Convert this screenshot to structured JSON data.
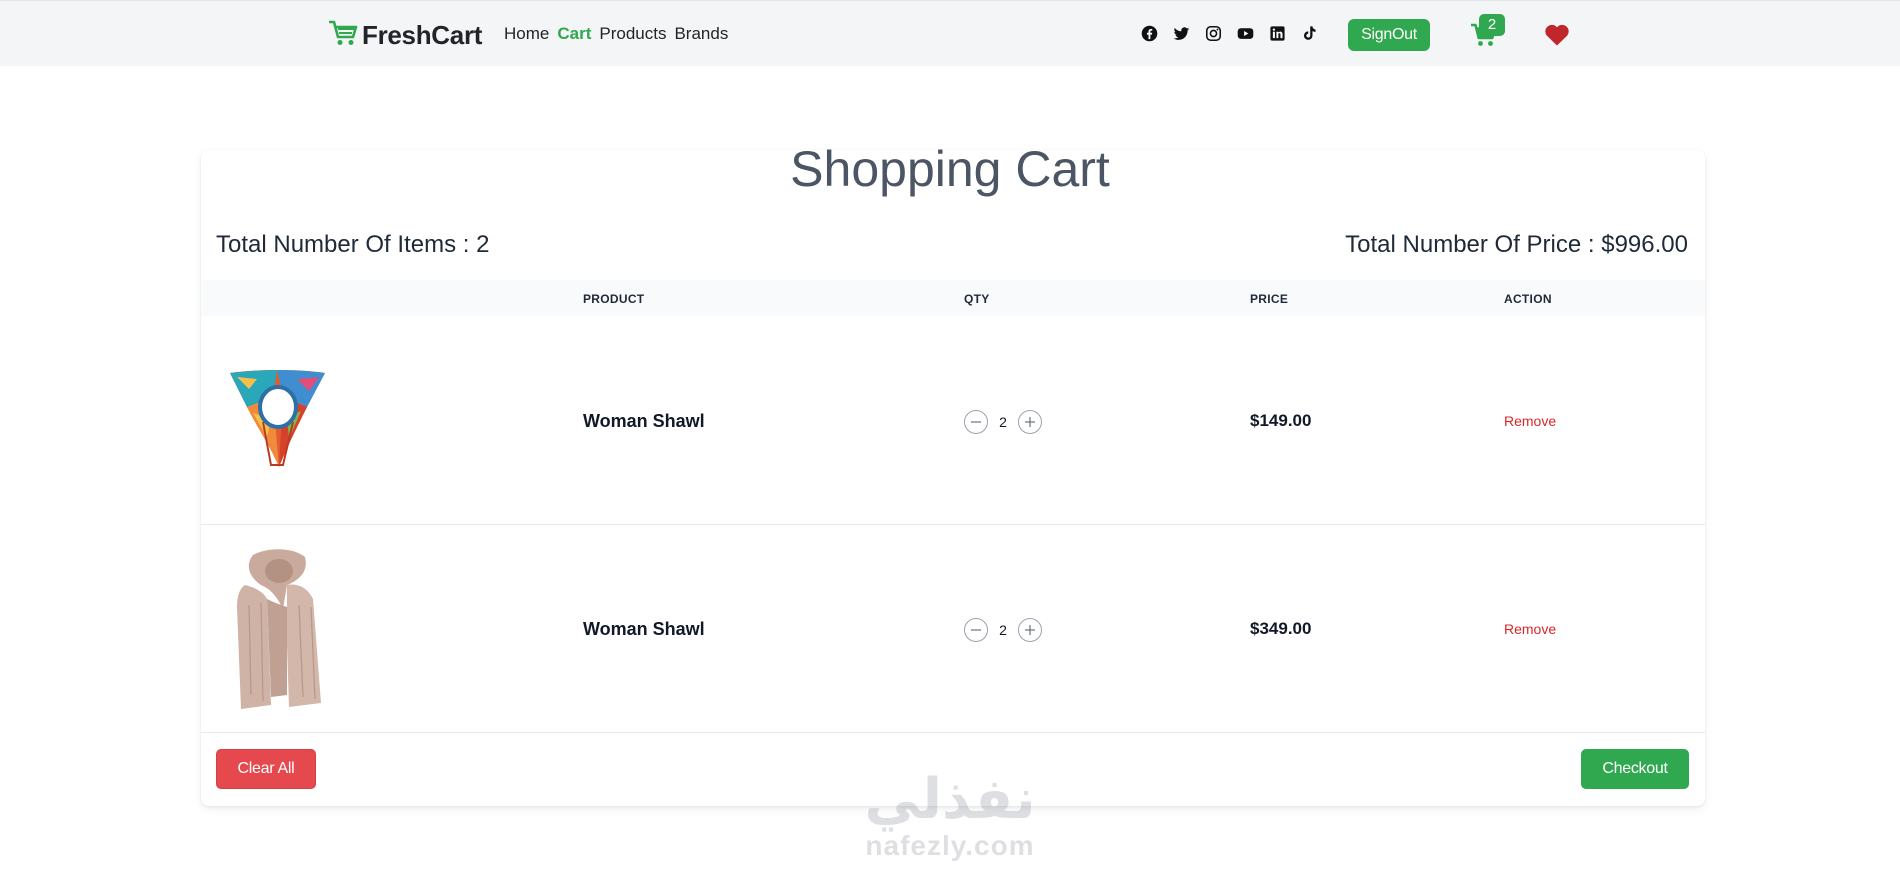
{
  "navbar": {
    "brand": "FreshCart",
    "links": [
      {
        "label": "Home",
        "active": false
      },
      {
        "label": "Cart",
        "active": true
      },
      {
        "label": "Products",
        "active": false
      },
      {
        "label": "Brands",
        "active": false
      }
    ],
    "socials": [
      "facebook-icon",
      "twitter-icon",
      "instagram-icon",
      "youtube-icon",
      "linkedin-icon",
      "tiktok-icon"
    ],
    "signout_label": "SignOut",
    "cart_count": "2",
    "accent_color": "#2fa84f",
    "heart_color": "#c0272d"
  },
  "cart": {
    "title": "Shopping Cart",
    "total_items_text": "Total Number Of Items : 2",
    "total_price_text": "Total Number Of Price : $996.00",
    "headers": {
      "product": "PRODUCT",
      "qty": "QTY",
      "price": "PRICE",
      "action": "ACTION"
    },
    "items": [
      {
        "name": "Woman Shawl",
        "qty": "2",
        "price": "$149.00",
        "action": "Remove",
        "image": "colorful-scarf"
      },
      {
        "name": "Woman Shawl",
        "qty": "2",
        "price": "$349.00",
        "action": "Remove",
        "image": "beige-scarf"
      }
    ],
    "clear_label": "Clear All",
    "checkout_label": "Checkout"
  },
  "watermark": {
    "arabic": "نفذلي",
    "latin": "nafezly.com"
  }
}
